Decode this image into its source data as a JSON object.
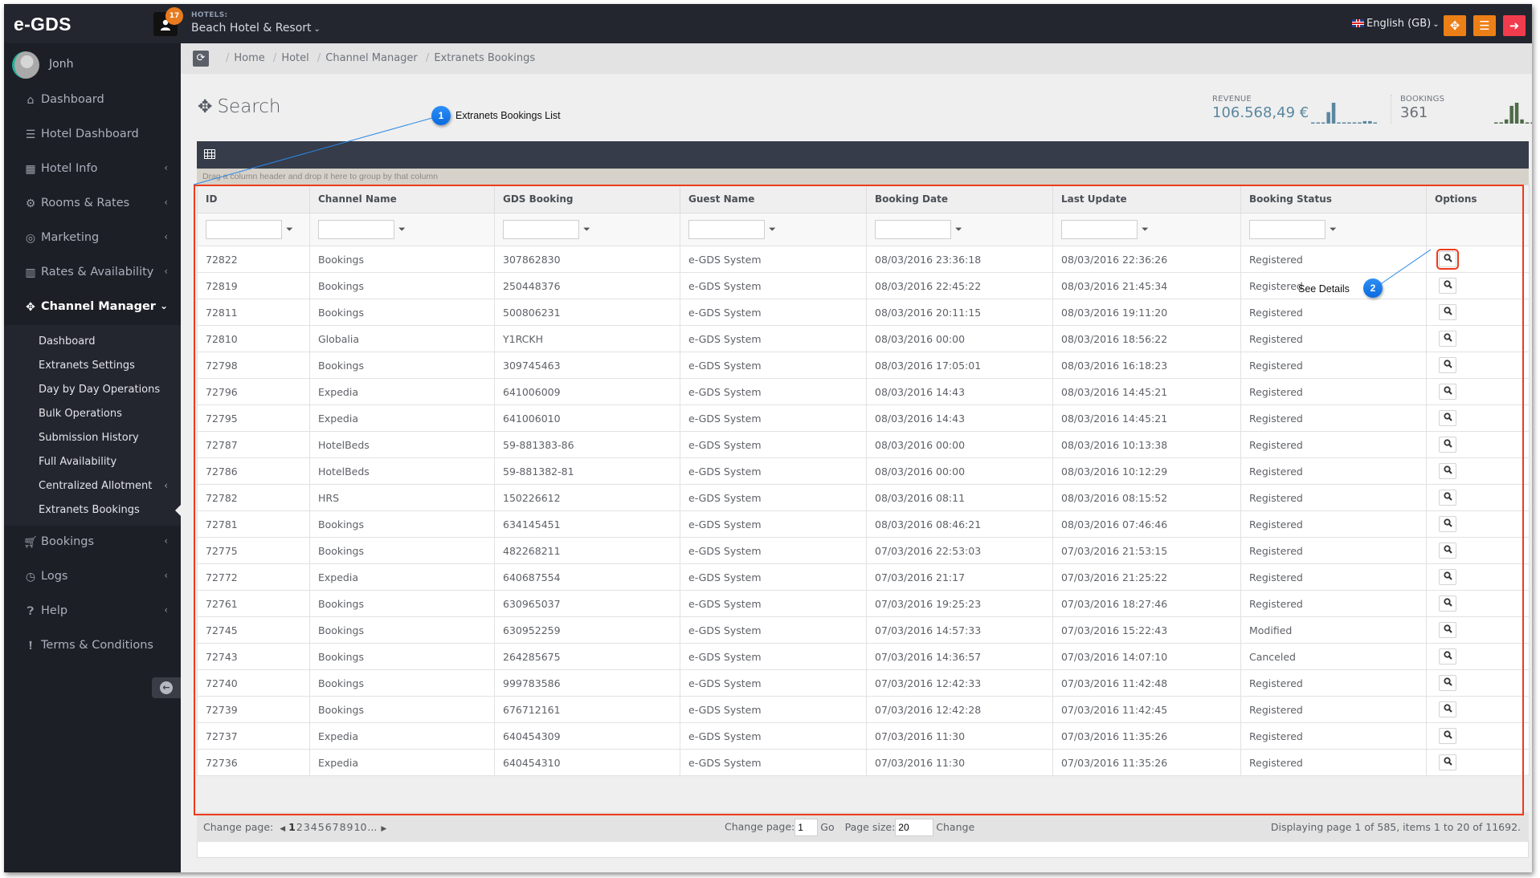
{
  "app": {
    "logo": "e-GDS",
    "notifications_count": "17",
    "hotels_label": "HOTELS:",
    "hotel_name": "Beach Hotel & Resort",
    "language": "English (GB)",
    "icons": {
      "fullscreen": "expand-arrows-icon",
      "menu": "hamburger-menu-icon",
      "logout": "sign-out-icon"
    },
    "colors": {
      "topbar": "#23262e",
      "sidebar": "#1d1f26",
      "orange_button": "#ed7f17",
      "red_button": "#f03c4d",
      "highlight": "#ee3a1a",
      "callout": "#1a7cf0",
      "revenue": "#5a87a0",
      "bookings_spark": "#4e6b48"
    }
  },
  "sidebar": {
    "username": "Jonh",
    "items": [
      {
        "label": "Dashboard",
        "icon": "home-icon",
        "has_arrow": false
      },
      {
        "label": "Hotel Dashboard",
        "icon": "tasks-icon",
        "has_arrow": false
      },
      {
        "label": "Hotel Info",
        "icon": "building-icon",
        "has_arrow": true
      },
      {
        "label": "Rooms & Rates",
        "icon": "cogs-icon",
        "has_arrow": true
      },
      {
        "label": "Marketing",
        "icon": "bullseye-icon",
        "has_arrow": true
      },
      {
        "label": "Rates & Availability",
        "icon": "bar-chart-icon",
        "has_arrow": true
      },
      {
        "label": "Channel Manager",
        "icon": "arrows-move-icon",
        "has_arrow": true,
        "expanded": true
      }
    ],
    "channel_manager_sub": [
      {
        "label": "Dashboard"
      },
      {
        "label": "Extranets Settings"
      },
      {
        "label": "Day by Day Operations"
      },
      {
        "label": "Bulk Operations"
      },
      {
        "label": "Submission History"
      },
      {
        "label": "Full Availability"
      },
      {
        "label": "Centralized Allotment",
        "has_arrow": true
      },
      {
        "label": "Extranets Bookings",
        "current": true
      }
    ],
    "items_after": [
      {
        "label": "Bookings",
        "icon": "shopping-cart-icon",
        "has_arrow": true
      },
      {
        "label": "Logs",
        "icon": "clock-icon",
        "has_arrow": true
      },
      {
        "label": "Help",
        "icon": "question-circle-icon",
        "has_arrow": true
      },
      {
        "label": "Terms & Conditions",
        "icon": "exclamation-circle-icon",
        "has_arrow": false
      }
    ]
  },
  "breadcrumb": [
    "Home",
    "Hotel",
    "Channel Manager",
    "Extranets Bookings"
  ],
  "page": {
    "title": "Search",
    "stats": {
      "revenue_label": "REVENUE",
      "revenue_value": "106.568,49 €",
      "revenue_spark": [
        0.05,
        0.05,
        0.05,
        0.55,
        1.0,
        0.05,
        0.05,
        0.05,
        0.05,
        0.05,
        0.12,
        0.12,
        0.05
      ],
      "bookings_label": "BOOKINGS",
      "bookings_value": "361",
      "bookings_spark": [
        0.05,
        0.05,
        0.2,
        0.85,
        1.0,
        0.2,
        0.05,
        0.05,
        0.25,
        0.05,
        0.05,
        0.45,
        0.05
      ]
    }
  },
  "grid": {
    "group_hint": "Drag a column header and drop it here to group by that column",
    "columns": [
      "ID",
      "Channel Name",
      "GDS Booking",
      "Guest Name",
      "Booking Date",
      "Last Update",
      "Booking Status",
      "Options"
    ],
    "rows": [
      [
        "72822",
        "Bookings",
        "307862830",
        "e-GDS System",
        "08/03/2016 23:36:18",
        "08/03/2016 22:36:26",
        "Registered"
      ],
      [
        "72819",
        "Bookings",
        "250448376",
        "e-GDS System",
        "08/03/2016 22:45:22",
        "08/03/2016 21:45:34",
        "Registered"
      ],
      [
        "72811",
        "Bookings",
        "500806231",
        "e-GDS System",
        "08/03/2016 20:11:15",
        "08/03/2016 19:11:20",
        "Registered"
      ],
      [
        "72810",
        "Globalia",
        "Y1RCKH",
        "e-GDS System",
        "08/03/2016 00:00",
        "08/03/2016 18:56:22",
        "Registered"
      ],
      [
        "72798",
        "Bookings",
        "309745463",
        "e-GDS System",
        "08/03/2016 17:05:01",
        "08/03/2016 16:18:23",
        "Registered"
      ],
      [
        "72796",
        "Expedia",
        "641006009",
        "e-GDS System",
        "08/03/2016 14:43",
        "08/03/2016 14:45:21",
        "Registered"
      ],
      [
        "72795",
        "Expedia",
        "641006010",
        "e-GDS System",
        "08/03/2016 14:43",
        "08/03/2016 14:45:21",
        "Registered"
      ],
      [
        "72787",
        "HotelBeds",
        "59-881383-86",
        "e-GDS System",
        "08/03/2016 00:00",
        "08/03/2016 10:13:38",
        "Registered"
      ],
      [
        "72786",
        "HotelBeds",
        "59-881382-81",
        "e-GDS System",
        "08/03/2016 00:00",
        "08/03/2016 10:12:29",
        "Registered"
      ],
      [
        "72782",
        "HRS",
        "150226612",
        "e-GDS System",
        "08/03/2016 08:11",
        "08/03/2016 08:15:52",
        "Registered"
      ],
      [
        "72781",
        "Bookings",
        "634145451",
        "e-GDS System",
        "08/03/2016 08:46:21",
        "08/03/2016 07:46:46",
        "Registered"
      ],
      [
        "72775",
        "Bookings",
        "482268211",
        "e-GDS System",
        "07/03/2016 22:53:03",
        "07/03/2016 21:53:15",
        "Registered"
      ],
      [
        "72772",
        "Expedia",
        "640687554",
        "e-GDS System",
        "07/03/2016 21:17",
        "07/03/2016 21:25:22",
        "Registered"
      ],
      [
        "72761",
        "Bookings",
        "630965037",
        "e-GDS System",
        "07/03/2016 19:25:23",
        "07/03/2016 18:27:46",
        "Registered"
      ],
      [
        "72745",
        "Bookings",
        "630952259",
        "e-GDS System",
        "07/03/2016 14:57:33",
        "07/03/2016 15:22:43",
        "Modified"
      ],
      [
        "72743",
        "Bookings",
        "264285675",
        "e-GDS System",
        "07/03/2016 14:36:57",
        "07/03/2016 14:07:10",
        "Canceled"
      ],
      [
        "72740",
        "Bookings",
        "999783586",
        "e-GDS System",
        "07/03/2016 12:42:33",
        "07/03/2016 11:42:48",
        "Registered"
      ],
      [
        "72739",
        "Bookings",
        "676712161",
        "e-GDS System",
        "07/03/2016 12:42:28",
        "07/03/2016 11:42:45",
        "Registered"
      ],
      [
        "72737",
        "Expedia",
        "640454309",
        "e-GDS System",
        "07/03/2016 11:30",
        "07/03/2016 11:35:26",
        "Registered"
      ],
      [
        "72736",
        "Expedia",
        "640454310",
        "e-GDS System",
        "07/03/2016 11:30",
        "07/03/2016 11:35:26",
        "Registered"
      ]
    ],
    "details_icon": "search-magnifier-icon",
    "filter_icon": "funnel-icon"
  },
  "pager": {
    "change_page_label": "Change page:",
    "pages": [
      "1",
      "2",
      "3",
      "4",
      "5",
      "6",
      "7",
      "8",
      "9",
      "10",
      "..."
    ],
    "current_page": "1",
    "goto_label": "Change page:",
    "goto_value": "1",
    "go_label": "Go",
    "page_size_label": "Page size:",
    "page_size_value": "20",
    "change_label": "Change",
    "summary": "Displaying page 1 of 585, items 1 to 20 of 11692."
  },
  "annotations": [
    {
      "number": "1",
      "text": "Extranets Bookings List"
    },
    {
      "number": "2",
      "text": "See Details"
    }
  ]
}
